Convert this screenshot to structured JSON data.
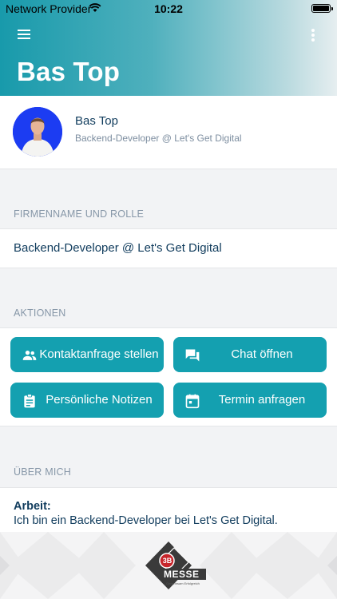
{
  "status_bar": {
    "carrier": "Network Provider",
    "time": "10:22"
  },
  "header": {
    "title": "Bas Top"
  },
  "profile": {
    "name": "Bas Top",
    "subtitle": "Backend-Developer @ Let's Get Digital"
  },
  "company_section": {
    "label": "FIRMENNAME UND ROLLE",
    "value": "Backend-Developer @ Let's Get Digital"
  },
  "actions_section": {
    "label": "AKTIONEN",
    "buttons": [
      {
        "label": "Kontaktanfrage stellen",
        "icon": "people-icon"
      },
      {
        "label": "Chat öffnen",
        "icon": "chat-icon"
      },
      {
        "label": "Persönliche Notizen",
        "icon": "clipboard-icon"
      },
      {
        "label": "Termin anfragen",
        "icon": "calendar-icon"
      }
    ]
  },
  "about_section": {
    "label": "ÜBER MICH",
    "title": "Arbeit:",
    "text": "Ich bin ein Backend-Developer bei Let's Get Digital."
  },
  "footer": {
    "logo_text": "MESSE",
    "logo_badge": "3B",
    "logo_tagline": "Gemeinsam Erfolgreich"
  },
  "colors": {
    "accent": "#14a0b0",
    "text": "#0f3b5c",
    "muted": "#8797a8"
  }
}
